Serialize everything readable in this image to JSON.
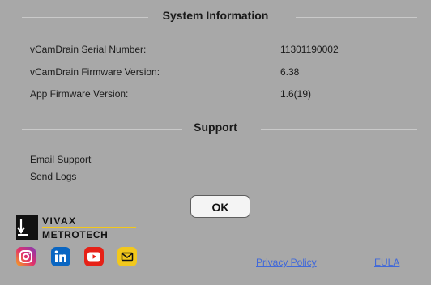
{
  "system_info": {
    "title": "System Information",
    "rows": [
      {
        "label": "vCamDrain Serial Number:",
        "value": "11301190002"
      },
      {
        "label": "vCamDrain Firmware Version:",
        "value": "6.38"
      },
      {
        "label": "App Firmware Version:",
        "value": "1.6(19)"
      }
    ]
  },
  "support": {
    "title": "Support",
    "email_label": "Email Support",
    "logs_label": "Send Logs"
  },
  "ok_label": "OK",
  "brand": {
    "line1": "VIVAX",
    "line2": "METROTECH",
    "accent_color": "#f2c81c"
  },
  "social_icons": [
    "instagram-icon",
    "linkedin-icon",
    "youtube-icon",
    "email-icon"
  ],
  "footer": {
    "privacy_label": "Privacy Policy",
    "eula_label": "EULA",
    "link_color": "#4169d9"
  }
}
